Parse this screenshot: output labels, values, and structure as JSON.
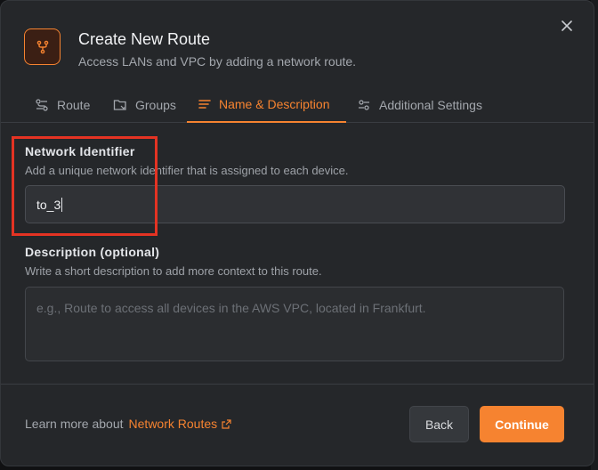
{
  "dialog": {
    "title": "Create New Route",
    "subtitle": "Access LANs and VPC by adding a network route.",
    "icon": "route-icon",
    "accent_color": "#f68330"
  },
  "tabs": [
    {
      "label": "Route",
      "icon": "route-settings-icon",
      "active": false
    },
    {
      "label": "Groups",
      "icon": "groups-icon",
      "active": false
    },
    {
      "label": "Name & Description",
      "icon": "text-lines-icon",
      "active": true
    },
    {
      "label": "Additional Settings",
      "icon": "sliders-icon",
      "active": false
    }
  ],
  "network_identifier": {
    "label": "Network Identifier",
    "help": "Add a unique network identifier that is assigned to each device.",
    "value": "to_3"
  },
  "description": {
    "label": "Description (optional)",
    "help": "Write a short description to add more context to this route.",
    "placeholder": "e.g., Route to access all devices in the AWS VPC, located in Frankfurt."
  },
  "footer": {
    "learn_prefix": "Learn more about",
    "learn_link": "Network Routes",
    "back_label": "Back",
    "continue_label": "Continue"
  },
  "annotation": {
    "highlight_color": "#e43323"
  }
}
